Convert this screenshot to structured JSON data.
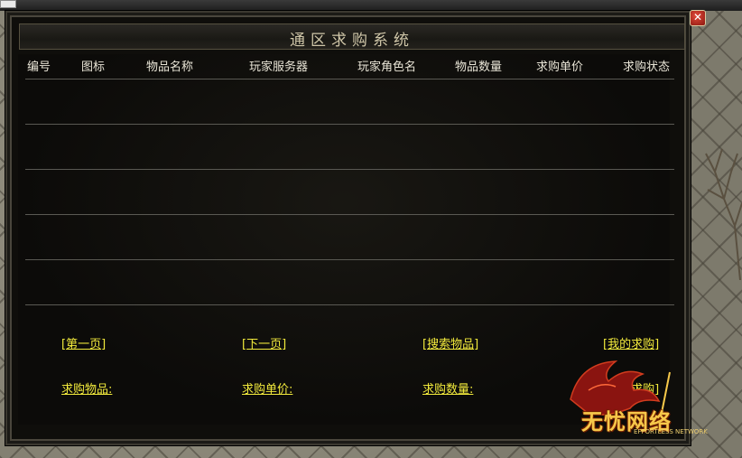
{
  "dialog": {
    "title": "通区求购系统",
    "close_label": "✕"
  },
  "table": {
    "headers": [
      "编号",
      "图标",
      "物品名称",
      "玩家服务器",
      "玩家角色名",
      "物品数量",
      "求购单价",
      "求购状态"
    ],
    "rows": []
  },
  "nav": {
    "first_page": "第一页",
    "next_page": "下一页",
    "search_items": "搜索物品",
    "my_purchases": "我的求购"
  },
  "form": {
    "item_label": "求购物品:",
    "price_label": "求购单价:",
    "quantity_label": "求购数量:",
    "start_label": "开始求购"
  },
  "logo": {
    "text": "无忧网络",
    "subtitle": "EFFORTLESS NETWORK"
  },
  "colors": {
    "link": "#f2ea3c",
    "header_text": "#e8e4d6",
    "panel_bg": "#0f0e0b",
    "close_button": "#c8281c"
  }
}
